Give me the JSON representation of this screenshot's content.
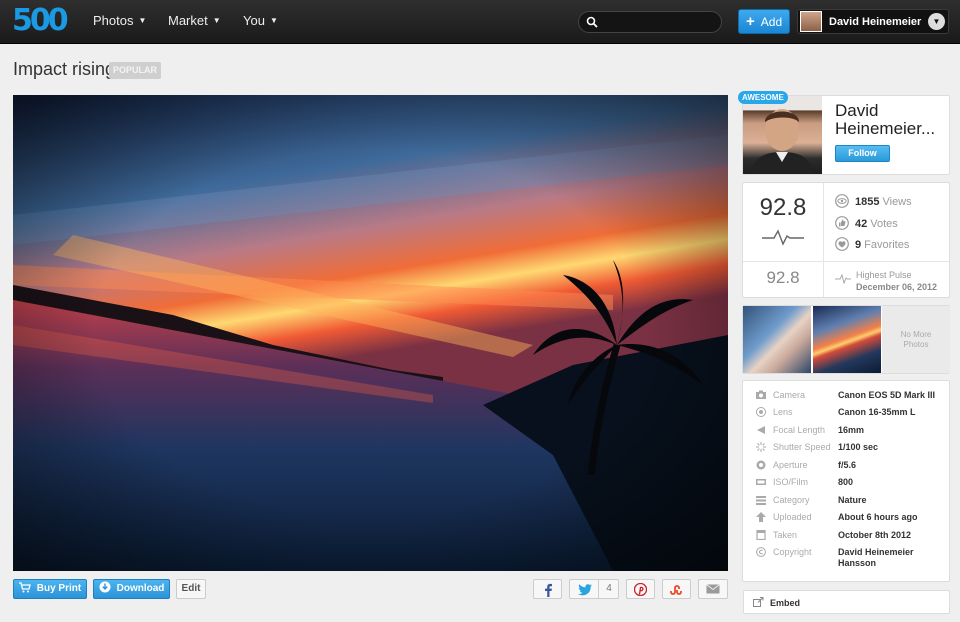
{
  "nav": {
    "logo": "500",
    "items": [
      {
        "label": "Photos"
      },
      {
        "label": "Market"
      },
      {
        "label": "You"
      }
    ],
    "search_placeholder": "",
    "add_label": "Add",
    "user_name": "David Heinemeier Hansson"
  },
  "photo": {
    "title": "Impact rising",
    "badge": "POPULAR"
  },
  "actions": {
    "buy_print": "Buy Print",
    "download": "Download",
    "edit": "Edit",
    "twitter_count": "4"
  },
  "owner": {
    "badge": "AWESOME",
    "name_line1": "David",
    "name_line2": "Heinemeier...",
    "follow_label": "Follow"
  },
  "stats": {
    "pulse": "92.8",
    "pulse_low": "92.8",
    "views_count": "1855",
    "views_label": "Views",
    "votes_count": "42",
    "votes_label": "Votes",
    "favorites_count": "9",
    "favorites_label": "Favorites",
    "highest_label": "Highest Pulse",
    "highest_date": "December 06, 2012"
  },
  "more_photos": {
    "no_more_line1": "No More",
    "no_more_line2": "Photos"
  },
  "exif": [
    {
      "label": "Camera",
      "value": "Canon EOS 5D Mark III",
      "icon": "camera-icon"
    },
    {
      "label": "Lens",
      "value": "Canon 16-35mm L",
      "icon": "lens-icon"
    },
    {
      "label": "Focal Length",
      "value": "16mm",
      "icon": "focal-length-icon"
    },
    {
      "label": "Shutter Speed",
      "value": "1/100 sec",
      "icon": "shutter-icon"
    },
    {
      "label": "Aperture",
      "value": "f/5.6",
      "icon": "aperture-icon"
    },
    {
      "label": "ISO/Film",
      "value": "800",
      "icon": "iso-icon"
    },
    {
      "label": "Category",
      "value": "Nature",
      "icon": "category-icon"
    },
    {
      "label": "Uploaded",
      "value": "About 6 hours ago",
      "icon": "upload-icon"
    },
    {
      "label": "Taken",
      "value": "October 8th 2012",
      "icon": "calendar-icon"
    },
    {
      "label": "Copyright",
      "value": "David Heinemeier Hansson",
      "icon": "copyright-icon"
    }
  ],
  "embed_label": "Embed",
  "colors": {
    "accent": "#1b9ae4",
    "topbar": "#222222",
    "background": "#efefef"
  }
}
